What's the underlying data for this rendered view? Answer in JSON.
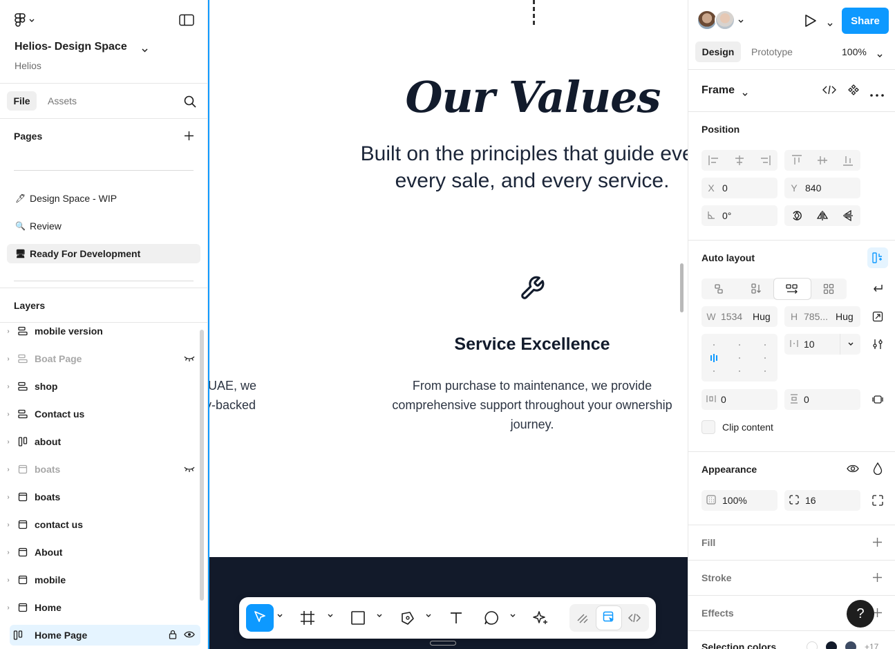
{
  "file": {
    "title": "Helios- Design Space",
    "team": "Helios"
  },
  "left_tabs": {
    "file": "File",
    "assets": "Assets"
  },
  "pages": {
    "label": "Pages",
    "items": [
      {
        "emoji": "🖊",
        "label": "Design Space - WIP"
      },
      {
        "emoji": "🔍",
        "label": "Review"
      },
      {
        "emoji": "🖥",
        "label": "Ready For Development",
        "active": true
      }
    ]
  },
  "layers": {
    "label": "Layers",
    "items": [
      {
        "label": "mobile version",
        "icon": "auto-layout-rows-icon"
      },
      {
        "label": "Boat Page",
        "icon": "auto-layout-rows-icon",
        "hidden": true
      },
      {
        "label": "shop",
        "icon": "auto-layout-rows-icon"
      },
      {
        "label": "Contact us",
        "icon": "auto-layout-rows-icon"
      },
      {
        "label": "about",
        "icon": "auto-layout-columns-icon"
      },
      {
        "label": "boats",
        "icon": "frame-icon",
        "hidden": true
      },
      {
        "label": "boats",
        "icon": "frame-icon"
      },
      {
        "label": "contact us",
        "icon": "frame-icon"
      },
      {
        "label": "About",
        "icon": "frame-icon"
      },
      {
        "label": "mobile",
        "icon": "frame-icon"
      },
      {
        "label": "Home",
        "icon": "frame-icon"
      },
      {
        "label": "Home Page",
        "icon": "auto-layout-columns-icon",
        "selected": true
      }
    ]
  },
  "canvas": {
    "heading": "Our Values",
    "subtitle_line1": "Built on the principles that guide every in",
    "subtitle_line2": "every sale, and every service.",
    "card_title": "Service Excellence",
    "card_desc_line1": "From purchase to maintenance, we provide",
    "card_desc_line2": "comprehensive support throughout your ownership",
    "card_desc_line3": "journey.",
    "left_fragment_line1": "UAE, we",
    "left_fragment_line2": "y-backed"
  },
  "header": {
    "share": "Share",
    "tab_design": "Design",
    "tab_prototype": "Prototype",
    "zoom": "100%"
  },
  "frame": {
    "label": "Frame"
  },
  "position": {
    "label": "Position",
    "x_label": "X",
    "x": "0",
    "y_label": "Y",
    "y": "840",
    "rotation": "0°"
  },
  "auto_layout": {
    "label": "Auto layout",
    "w_label": "W",
    "w": "1534",
    "w_mode": "Hug",
    "h_label": "H",
    "h": "785...",
    "h_mode": "Hug",
    "gap": "10",
    "padding_h": "0",
    "padding_v": "0",
    "clip_content": "Clip content"
  },
  "appearance": {
    "label": "Appearance",
    "opacity": "100%",
    "radius": "16"
  },
  "fill": {
    "label": "Fill"
  },
  "stroke": {
    "label": "Stroke"
  },
  "effects": {
    "label": "Effects"
  },
  "selection_colors": {
    "label": "Selection colors",
    "more": "+17",
    "colors": [
      "#ffffff",
      "#121a2a",
      "#3d4b63"
    ]
  },
  "help": "?",
  "colors": {
    "accent": "#0d99ff",
    "dark_band": "#121a2a"
  }
}
